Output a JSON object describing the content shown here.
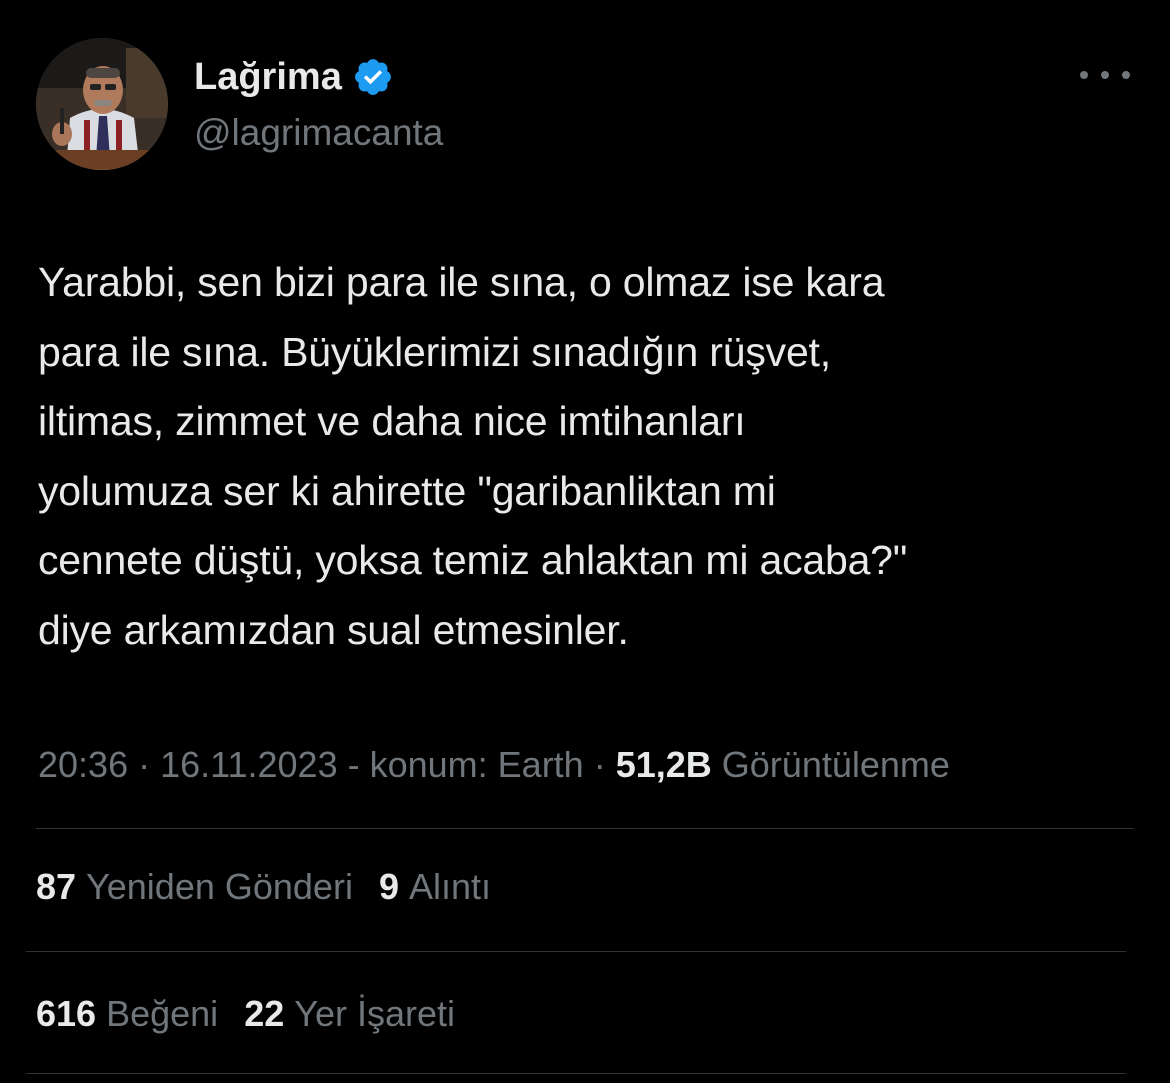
{
  "author": {
    "display_name": "Lağrima",
    "handle": "@lagrimacanta",
    "verified": true
  },
  "tweet": {
    "lines": [
      "Yarabbi, sen bizi para ile sına, o olmaz ise kara",
      "para ile sına. Büyüklerimizi sınadığın rüşvet,",
      "iltimas, zimmet ve daha nice imtihanları",
      "yolumuza ser ki ahirette \"garibanliktan mi",
      "cennete düştü, yoksa temiz ahlaktan mi acaba?\"",
      "diye arkamızdan sual etmesinler."
    ]
  },
  "meta": {
    "time": "20:36",
    "sep1": " · ",
    "date": "16.11.2023",
    "location": " - konum: Earth",
    "sep2": " · ",
    "views_count": "51,2B",
    "views_label": " Görüntülenme"
  },
  "stats": {
    "reposts_count": "87",
    "reposts_label": "Yeniden Gönderi",
    "quotes_count": "9",
    "quotes_label": "Alıntı",
    "likes_count": "616",
    "likes_label": "Beğeni",
    "bookmarks_count": "22",
    "bookmarks_label": "Yer İşareti"
  },
  "colors": {
    "background": "#000000",
    "text_primary": "#e7e9ea",
    "text_secondary": "#71767b",
    "verified_badge": "#1d9bf0",
    "divider": "#2f3336"
  },
  "icons": {
    "verified": "verified-badge-icon",
    "more": "more-options-icon"
  }
}
